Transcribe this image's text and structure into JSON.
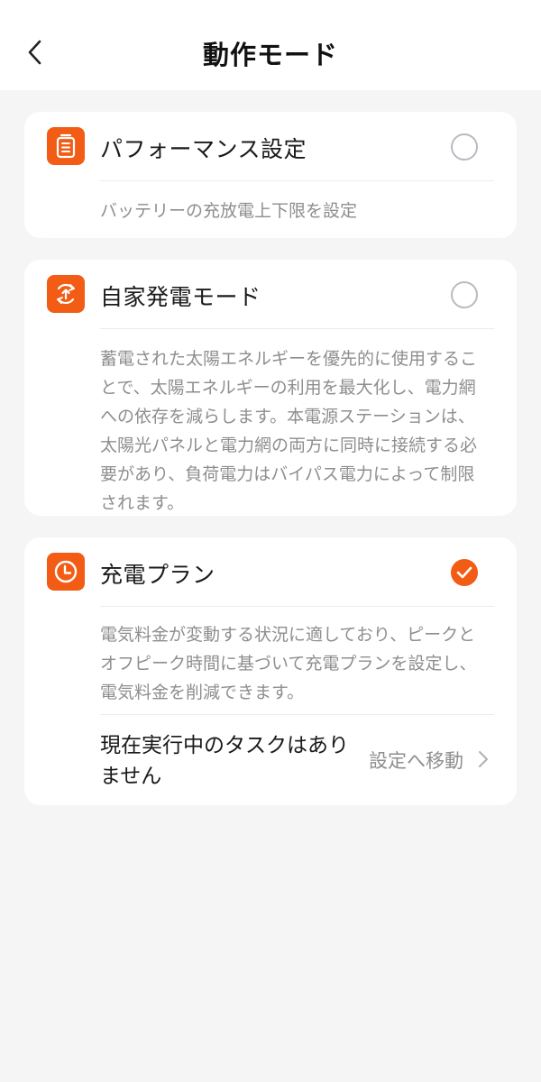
{
  "header": {
    "title": "動作モード",
    "back_icon": "chevron-left-icon"
  },
  "modes": [
    {
      "title": "パフォーマンス設定",
      "description": "バッテリーの充放電上下限を設定",
      "icon": "battery-settings-icon",
      "selected": false
    },
    {
      "title": "自家発電モード",
      "description": "蓄電された太陽エネルギーを優先的に使用することで、太陽エネルギーの利用を最大化し、電力網への依存を減らします。本電源ステーションは、太陽光パネルと電力網の両方に同時に接続する必要があり、負荷電力はバイパス電力によって制限されます。",
      "icon": "self-generation-icon",
      "selected": false
    },
    {
      "title": "充電プラン",
      "description": "電気料金が変動する状況に適しており、ピークとオフピーク時間に基づいて充電プランを設定し、電気料金を削減できます。",
      "icon": "clock-icon",
      "selected": true,
      "task_status": "現在実行中のタスクはありません",
      "task_link": "設定へ移動"
    }
  ],
  "colors": {
    "accent": "#f25c15",
    "background": "#f5f5f5",
    "card": "#ffffff",
    "secondary_text": "#8e8e8e"
  }
}
